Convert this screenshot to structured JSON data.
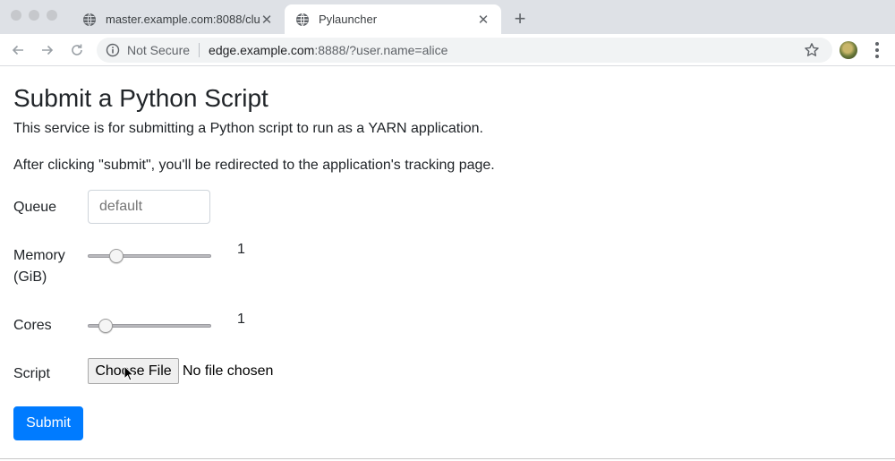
{
  "browser": {
    "tabs": [
      {
        "title": "master.example.com:8088/clu",
        "active": false,
        "icon": "globe-icon"
      },
      {
        "title": "Pylauncher",
        "active": true,
        "icon": "globe-icon"
      }
    ],
    "new_tab_label": "+",
    "address_bar": {
      "security_text": "Not Secure",
      "url_host": "edge.example.com",
      "url_rest": ":8888/?user.name=alice"
    }
  },
  "page": {
    "title": "Submit a Python Script",
    "description": "This service is for submitting a Python script to run as a YARN application.",
    "redirect_note": "After clicking \"submit\", you'll be redirected to the application's tracking page.",
    "form": {
      "queue_label": "Queue",
      "queue_placeholder": "default",
      "memory_label_line1": "Memory",
      "memory_label_line2": "(GiB)",
      "memory_value": "1",
      "memory_slider_fraction": 0.2,
      "cores_label": "Cores",
      "cores_value": "1",
      "cores_slider_fraction": 0.1,
      "script_label": "Script",
      "file_button_label": "Choose File",
      "file_status": "No file chosen",
      "submit_label": "Submit"
    }
  },
  "colors": {
    "primary": "#007bff",
    "tabstrip": "#dee1e6",
    "text": "#212529"
  }
}
